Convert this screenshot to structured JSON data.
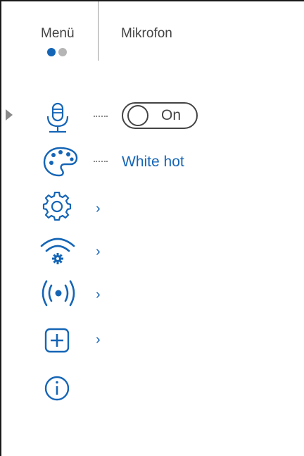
{
  "header": {
    "menu_label": "Menü",
    "active_tab_label": "Mikrofon",
    "page_dots": 2,
    "current_page": 1
  },
  "colors": {
    "accent": "#1565b6",
    "text": "#444444",
    "dot_active": "#1565b6",
    "dot_inactive": "#b5b5b5"
  },
  "menu": {
    "items": [
      {
        "icon": "microphone-icon",
        "control": "toggle",
        "value": "On"
      },
      {
        "icon": "palette-icon",
        "control": "value",
        "value": "White hot"
      },
      {
        "icon": "settings-gear-icon",
        "control": "submenu"
      },
      {
        "icon": "wifi-settings-icon",
        "control": "submenu"
      },
      {
        "icon": "broadcast-icon",
        "control": "submenu"
      },
      {
        "icon": "add-box-icon",
        "control": "submenu"
      },
      {
        "icon": "info-icon",
        "control": "none"
      }
    ]
  }
}
